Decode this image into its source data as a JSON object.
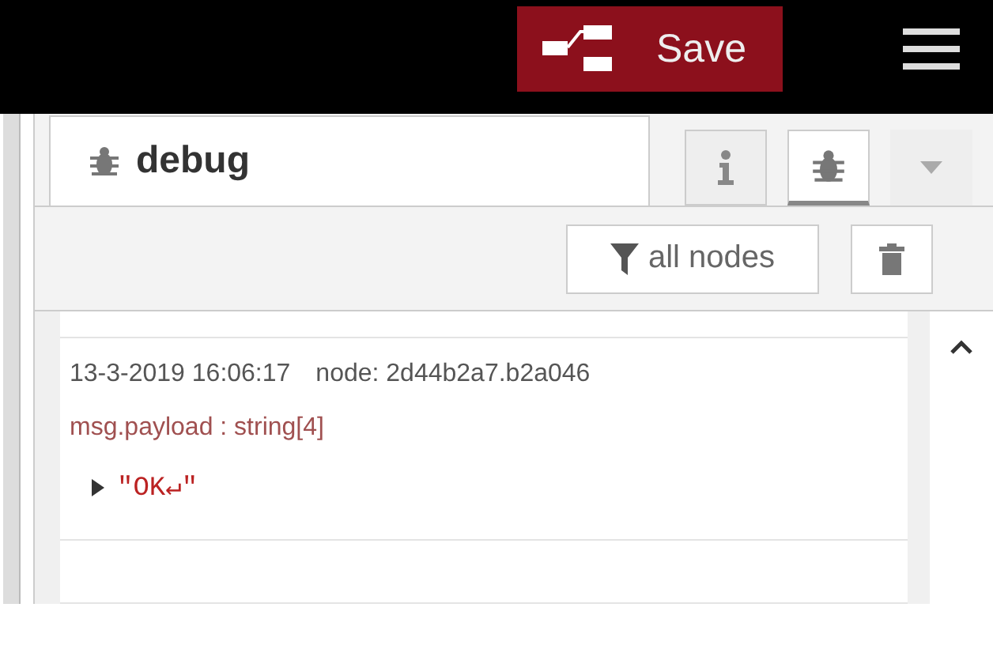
{
  "header": {
    "save_button": "Save"
  },
  "sidebar": {
    "tabs": [
      {
        "label": "debug",
        "selected": true
      }
    ],
    "tab_buttons": [
      {
        "kind": "info",
        "selected": false
      },
      {
        "kind": "debug",
        "selected": true
      },
      {
        "kind": "menu",
        "selected": false
      }
    ]
  },
  "toolbar": {
    "filter_button": "all nodes"
  },
  "messages": [
    {
      "timestamp": "13-3-2019 16:06:17",
      "node": "node: 2d44b2a7.b2a046",
      "topic": "msg.payload : string[4]",
      "value": "\"OK↵\"",
      "expanded": false
    }
  ]
}
